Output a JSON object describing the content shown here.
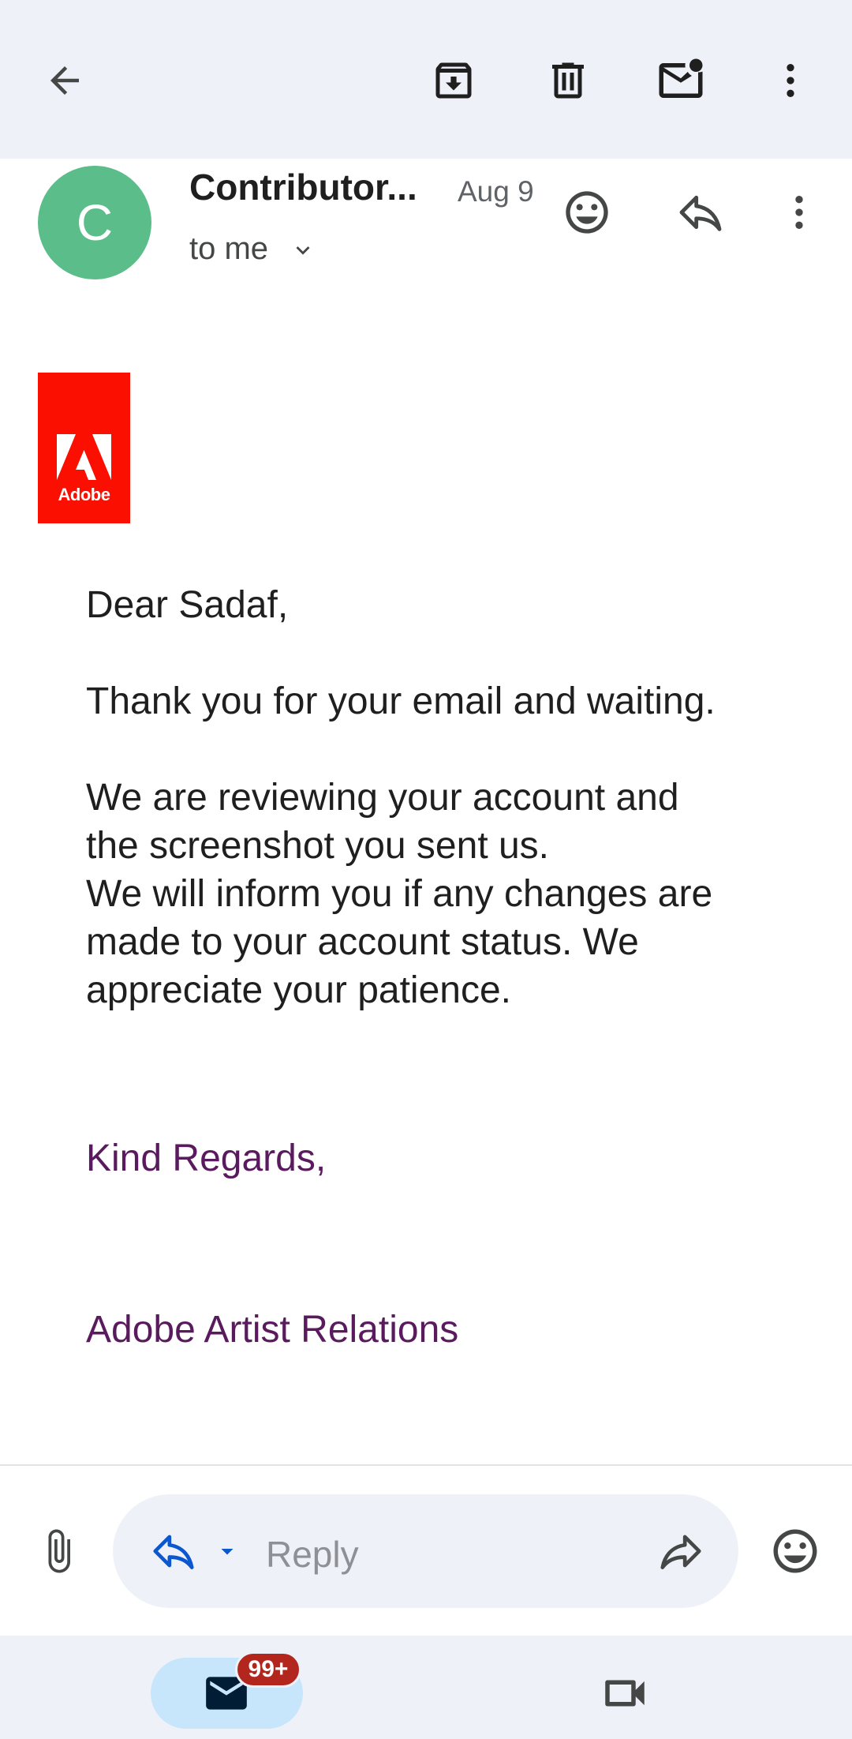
{
  "toolbar": {
    "back_icon": "arrow-back-icon",
    "archive_icon": "archive-icon",
    "delete_icon": "trash-icon",
    "mark_unread_icon": "mark-unread-icon",
    "more_icon": "more-vert-icon"
  },
  "message": {
    "avatar_letter": "C",
    "avatar_color": "#5bbd8a",
    "sender": "Contributor...",
    "date": "Aug 9",
    "recipient": "to me",
    "logo_text": "Adobe",
    "brand_color": "#fa0f00",
    "body": {
      "greeting": "Dear Sadaf,",
      "line1": "Thank you for your email and waiting.",
      "line2": "We are reviewing your account and",
      "line3": "the screenshot you sent us.",
      "line4": "We will inform you if any changes are",
      "line5": "made to your account status. We",
      "line6": "appreciate your patience."
    },
    "signoff": "Kind Regards,",
    "signature": "Adobe Artist Relations",
    "signature_color": "#5a1b5e"
  },
  "reply_bar": {
    "placeholder": "Reply"
  },
  "bottom_nav": {
    "mail_badge": "99+",
    "badge_color": "#b3261e",
    "active_color": "#c7e5fb"
  }
}
